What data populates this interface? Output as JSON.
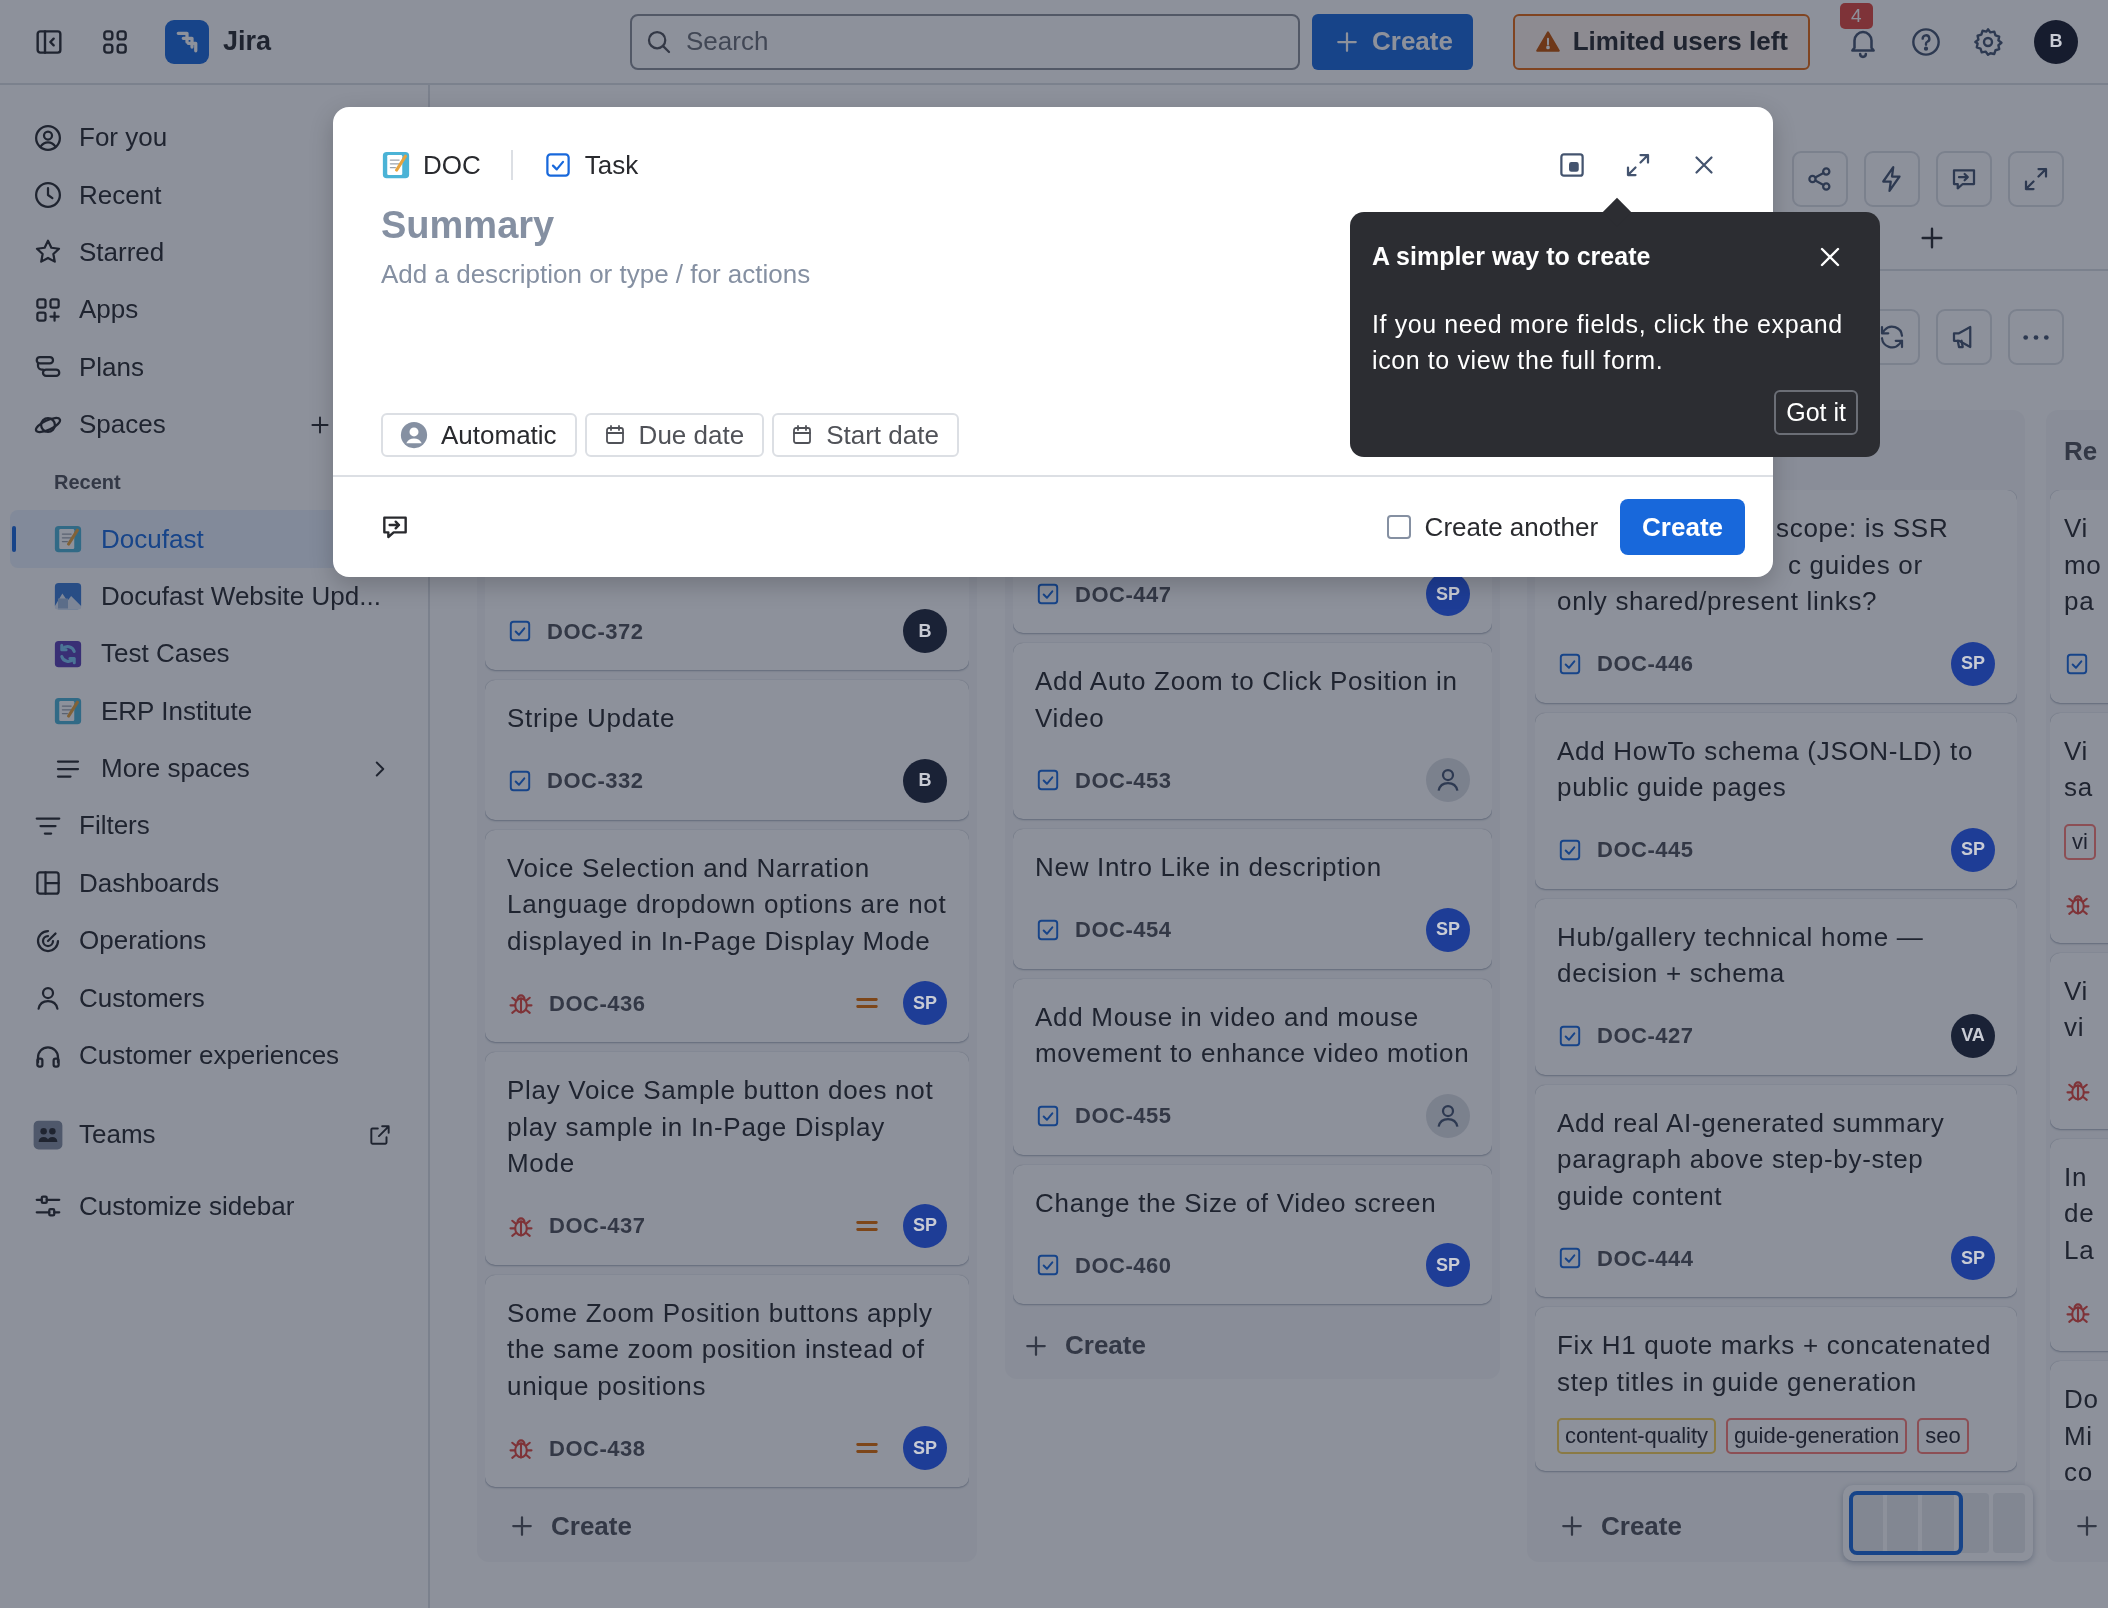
{
  "topbar": {
    "product": "Jira",
    "search": {
      "placeholder": "Search"
    },
    "create": "Create",
    "notice": "Limited users left",
    "notification_count": "4",
    "avatar": {
      "initials": "B",
      "color": "#161c2e"
    }
  },
  "sidebar": {
    "items": [
      {
        "kind": "link",
        "label": "For you"
      },
      {
        "kind": "link",
        "label": "Recent"
      },
      {
        "kind": "link",
        "label": "Starred"
      },
      {
        "kind": "link",
        "label": "Apps"
      },
      {
        "kind": "link",
        "label": "Plans"
      },
      {
        "kind": "section",
        "label": "Spaces"
      },
      {
        "kind": "heading",
        "label": "Recent"
      },
      {
        "kind": "space",
        "label": "Docufast",
        "selected": true
      },
      {
        "kind": "space",
        "label": "Docufast Website Upd...",
        "selected": false
      },
      {
        "kind": "space",
        "label": "Test Cases",
        "selected": false
      },
      {
        "kind": "space",
        "label": "ERP Institute",
        "selected": false
      },
      {
        "kind": "more",
        "label": "More spaces"
      },
      {
        "kind": "link",
        "label": "Filters"
      },
      {
        "kind": "link",
        "label": "Dashboards"
      },
      {
        "kind": "link",
        "label": "Operations"
      },
      {
        "kind": "link",
        "label": "Customers"
      },
      {
        "kind": "link",
        "label": "Customer experiences"
      },
      {
        "kind": "team",
        "label": "Teams"
      },
      {
        "kind": "customize",
        "label": "Customize sidebar"
      }
    ]
  },
  "board": {
    "columns": [
      {
        "cards": [
          {
            "kind": "task",
            "id": "DOC-372",
            "avatar": {
              "initials": "B",
              "color": "#1a2236"
            }
          },
          {
            "kind": "task",
            "title": "Stripe Update",
            "id": "DOC-332",
            "avatar": {
              "initials": "B",
              "color": "#1a2236"
            }
          },
          {
            "kind": "bug",
            "title": "Voice Selection and Narration Language dropdown options are not displayed in In-Page Display Mode",
            "id": "DOC-436",
            "medium_priority": true,
            "avatar": {
              "initials": "SP",
              "color": "#1e3d96"
            }
          },
          {
            "kind": "bug",
            "title": "Play Voice Sample button does not play sample in In-Page Display Mode",
            "id": "DOC-437",
            "medium_priority": true,
            "avatar": {
              "initials": "SP",
              "color": "#1e3d96"
            }
          },
          {
            "kind": "bug",
            "title": "Some Zoom Position buttons apply the same zoom position instead of unique positions",
            "id": "DOC-438",
            "medium_priority": true,
            "avatar": {
              "initials": "SP",
              "color": "#1e3d96"
            }
          }
        ],
        "create": {
          "kind": "sticky",
          "label": "Create"
        }
      },
      {
        "cards": [
          {
            "kind": "task",
            "id": "DOC-447",
            "avatar": {
              "initials": "SP",
              "color": "#1e3d96"
            }
          },
          {
            "kind": "task",
            "title": "Add Auto Zoom to Click Position in Video",
            "id": "DOC-453",
            "avatar": {
              "kind": "unassigned"
            }
          },
          {
            "kind": "task",
            "title": "New Intro Like in description",
            "id": "DOC-454",
            "avatar": {
              "initials": "SP",
              "color": "#1e3d96"
            }
          },
          {
            "kind": "task",
            "title": "Add Mouse in video and mouse movement to enhance video motion",
            "id": "DOC-455",
            "avatar": {
              "kind": "unassigned"
            }
          },
          {
            "kind": "task",
            "title": "Change the Size of Video screen",
            "id": "DOC-460",
            "avatar": {
              "initials": "SP",
              "color": "#1e3d96"
            }
          }
        ],
        "create": {
          "kind": "inline",
          "label": "Create"
        }
      },
      {
        "cards": [
          {
            "kind": "task",
            "title_lines": [
              "scope: is SSR",
              "c guides or",
              "only shared/present links?"
            ],
            "id": "DOC-446",
            "avatar": {
              "initials": "SP",
              "color": "#1e3d96"
            }
          },
          {
            "kind": "task",
            "title": "Add HowTo schema (JSON-LD) to public guide pages",
            "id": "DOC-445",
            "avatar": {
              "initials": "SP",
              "color": "#1e3d96"
            }
          },
          {
            "kind": "task",
            "title": "Hub/gallery technical home — decision + schema",
            "id": "DOC-427",
            "avatar": {
              "initials": "VA",
              "color": "#1a2236"
            }
          },
          {
            "kind": "task",
            "title": "Add real AI-generated summary paragraph above step-by-step guide content",
            "id": "DOC-444",
            "avatar": {
              "initials": "SP",
              "color": "#1e3d96"
            }
          },
          {
            "kind": "plain",
            "title": "Fix H1 quote marks + concatenated step titles in guide generation",
            "tags": [
              {
                "label": "content-quality",
                "color": "#8a7a45"
              },
              {
                "label": "guide-generation",
                "color": "#8c4f55"
              },
              {
                "label": "seo",
                "color": "#8c4f55"
              }
            ]
          }
        ],
        "create": {
          "kind": "sticky",
          "label": "Create"
        }
      },
      {
        "title": "Re",
        "cards": [
          {
            "kind": "task",
            "title_lines": [
              "Vi",
              "mo",
              "pa"
            ]
          },
          {
            "kind": "bug",
            "title_lines": [
              "Vi",
              "sa"
            ],
            "tags": [
              {
                "label": "vi",
                "color": "#8c4f55"
              }
            ]
          },
          {
            "kind": "bug",
            "title_lines": [
              "Vi",
              "vi"
            ]
          },
          {
            "kind": "bug",
            "title_lines": [
              "In",
              "de",
              "La"
            ]
          },
          {
            "kind": "plain",
            "title_lines": [
              "Do",
              "Mi",
              "co"
            ]
          }
        ],
        "create": {
          "kind": "sticky"
        }
      }
    ]
  },
  "modal": {
    "project": "DOC",
    "issue_type": "Task",
    "summary": {
      "placeholder": "Summary"
    },
    "description": {
      "placeholder": "Add a description or type / for actions"
    },
    "fields": [
      "Automatic",
      "Due date",
      "Start date"
    ],
    "create_another": {
      "label": "Create another",
      "checked": false
    },
    "submit": "Create"
  },
  "tooltip": {
    "title": "A simpler way to create",
    "body": "If you need more fields, click the expand icon to view the full form.",
    "button": "Got it"
  }
}
